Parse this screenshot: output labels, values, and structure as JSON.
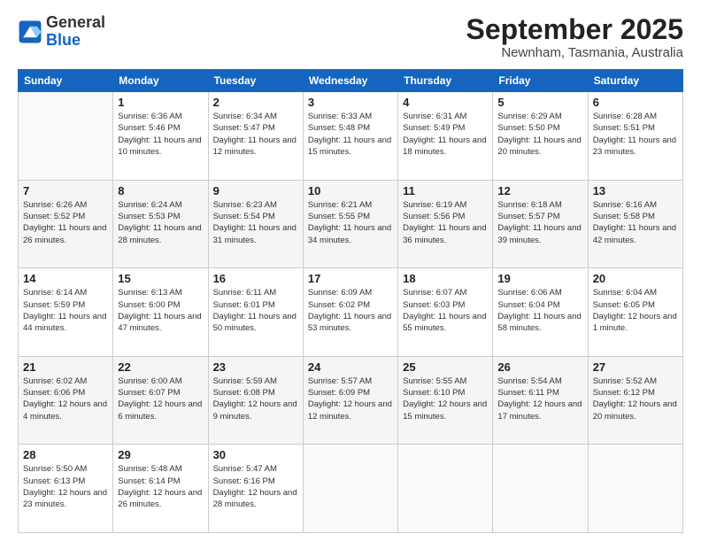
{
  "logo": {
    "general": "General",
    "blue": "Blue"
  },
  "header": {
    "month": "September 2025",
    "location": "Newnham, Tasmania, Australia"
  },
  "weekdays": [
    "Sunday",
    "Monday",
    "Tuesday",
    "Wednesday",
    "Thursday",
    "Friday",
    "Saturday"
  ],
  "weeks": [
    [
      {
        "day": "",
        "sunrise": "",
        "sunset": "",
        "daylight": ""
      },
      {
        "day": "1",
        "sunrise": "Sunrise: 6:36 AM",
        "sunset": "Sunset: 5:46 PM",
        "daylight": "Daylight: 11 hours and 10 minutes."
      },
      {
        "day": "2",
        "sunrise": "Sunrise: 6:34 AM",
        "sunset": "Sunset: 5:47 PM",
        "daylight": "Daylight: 11 hours and 12 minutes."
      },
      {
        "day": "3",
        "sunrise": "Sunrise: 6:33 AM",
        "sunset": "Sunset: 5:48 PM",
        "daylight": "Daylight: 11 hours and 15 minutes."
      },
      {
        "day": "4",
        "sunrise": "Sunrise: 6:31 AM",
        "sunset": "Sunset: 5:49 PM",
        "daylight": "Daylight: 11 hours and 18 minutes."
      },
      {
        "day": "5",
        "sunrise": "Sunrise: 6:29 AM",
        "sunset": "Sunset: 5:50 PM",
        "daylight": "Daylight: 11 hours and 20 minutes."
      },
      {
        "day": "6",
        "sunrise": "Sunrise: 6:28 AM",
        "sunset": "Sunset: 5:51 PM",
        "daylight": "Daylight: 11 hours and 23 minutes."
      }
    ],
    [
      {
        "day": "7",
        "sunrise": "Sunrise: 6:26 AM",
        "sunset": "Sunset: 5:52 PM",
        "daylight": "Daylight: 11 hours and 26 minutes."
      },
      {
        "day": "8",
        "sunrise": "Sunrise: 6:24 AM",
        "sunset": "Sunset: 5:53 PM",
        "daylight": "Daylight: 11 hours and 28 minutes."
      },
      {
        "day": "9",
        "sunrise": "Sunrise: 6:23 AM",
        "sunset": "Sunset: 5:54 PM",
        "daylight": "Daylight: 11 hours and 31 minutes."
      },
      {
        "day": "10",
        "sunrise": "Sunrise: 6:21 AM",
        "sunset": "Sunset: 5:55 PM",
        "daylight": "Daylight: 11 hours and 34 minutes."
      },
      {
        "day": "11",
        "sunrise": "Sunrise: 6:19 AM",
        "sunset": "Sunset: 5:56 PM",
        "daylight": "Daylight: 11 hours and 36 minutes."
      },
      {
        "day": "12",
        "sunrise": "Sunrise: 6:18 AM",
        "sunset": "Sunset: 5:57 PM",
        "daylight": "Daylight: 11 hours and 39 minutes."
      },
      {
        "day": "13",
        "sunrise": "Sunrise: 6:16 AM",
        "sunset": "Sunset: 5:58 PM",
        "daylight": "Daylight: 11 hours and 42 minutes."
      }
    ],
    [
      {
        "day": "14",
        "sunrise": "Sunrise: 6:14 AM",
        "sunset": "Sunset: 5:59 PM",
        "daylight": "Daylight: 11 hours and 44 minutes."
      },
      {
        "day": "15",
        "sunrise": "Sunrise: 6:13 AM",
        "sunset": "Sunset: 6:00 PM",
        "daylight": "Daylight: 11 hours and 47 minutes."
      },
      {
        "day": "16",
        "sunrise": "Sunrise: 6:11 AM",
        "sunset": "Sunset: 6:01 PM",
        "daylight": "Daylight: 11 hours and 50 minutes."
      },
      {
        "day": "17",
        "sunrise": "Sunrise: 6:09 AM",
        "sunset": "Sunset: 6:02 PM",
        "daylight": "Daylight: 11 hours and 53 minutes."
      },
      {
        "day": "18",
        "sunrise": "Sunrise: 6:07 AM",
        "sunset": "Sunset: 6:03 PM",
        "daylight": "Daylight: 11 hours and 55 minutes."
      },
      {
        "day": "19",
        "sunrise": "Sunrise: 6:06 AM",
        "sunset": "Sunset: 6:04 PM",
        "daylight": "Daylight: 11 hours and 58 minutes."
      },
      {
        "day": "20",
        "sunrise": "Sunrise: 6:04 AM",
        "sunset": "Sunset: 6:05 PM",
        "daylight": "Daylight: 12 hours and 1 minute."
      }
    ],
    [
      {
        "day": "21",
        "sunrise": "Sunrise: 6:02 AM",
        "sunset": "Sunset: 6:06 PM",
        "daylight": "Daylight: 12 hours and 4 minutes."
      },
      {
        "day": "22",
        "sunrise": "Sunrise: 6:00 AM",
        "sunset": "Sunset: 6:07 PM",
        "daylight": "Daylight: 12 hours and 6 minutes."
      },
      {
        "day": "23",
        "sunrise": "Sunrise: 5:59 AM",
        "sunset": "Sunset: 6:08 PM",
        "daylight": "Daylight: 12 hours and 9 minutes."
      },
      {
        "day": "24",
        "sunrise": "Sunrise: 5:57 AM",
        "sunset": "Sunset: 6:09 PM",
        "daylight": "Daylight: 12 hours and 12 minutes."
      },
      {
        "day": "25",
        "sunrise": "Sunrise: 5:55 AM",
        "sunset": "Sunset: 6:10 PM",
        "daylight": "Daylight: 12 hours and 15 minutes."
      },
      {
        "day": "26",
        "sunrise": "Sunrise: 5:54 AM",
        "sunset": "Sunset: 6:11 PM",
        "daylight": "Daylight: 12 hours and 17 minutes."
      },
      {
        "day": "27",
        "sunrise": "Sunrise: 5:52 AM",
        "sunset": "Sunset: 6:12 PM",
        "daylight": "Daylight: 12 hours and 20 minutes."
      }
    ],
    [
      {
        "day": "28",
        "sunrise": "Sunrise: 5:50 AM",
        "sunset": "Sunset: 6:13 PM",
        "daylight": "Daylight: 12 hours and 23 minutes."
      },
      {
        "day": "29",
        "sunrise": "Sunrise: 5:48 AM",
        "sunset": "Sunset: 6:14 PM",
        "daylight": "Daylight: 12 hours and 26 minutes."
      },
      {
        "day": "30",
        "sunrise": "Sunrise: 5:47 AM",
        "sunset": "Sunset: 6:16 PM",
        "daylight": "Daylight: 12 hours and 28 minutes."
      },
      {
        "day": "",
        "sunrise": "",
        "sunset": "",
        "daylight": ""
      },
      {
        "day": "",
        "sunrise": "",
        "sunset": "",
        "daylight": ""
      },
      {
        "day": "",
        "sunrise": "",
        "sunset": "",
        "daylight": ""
      },
      {
        "day": "",
        "sunrise": "",
        "sunset": "",
        "daylight": ""
      }
    ]
  ]
}
